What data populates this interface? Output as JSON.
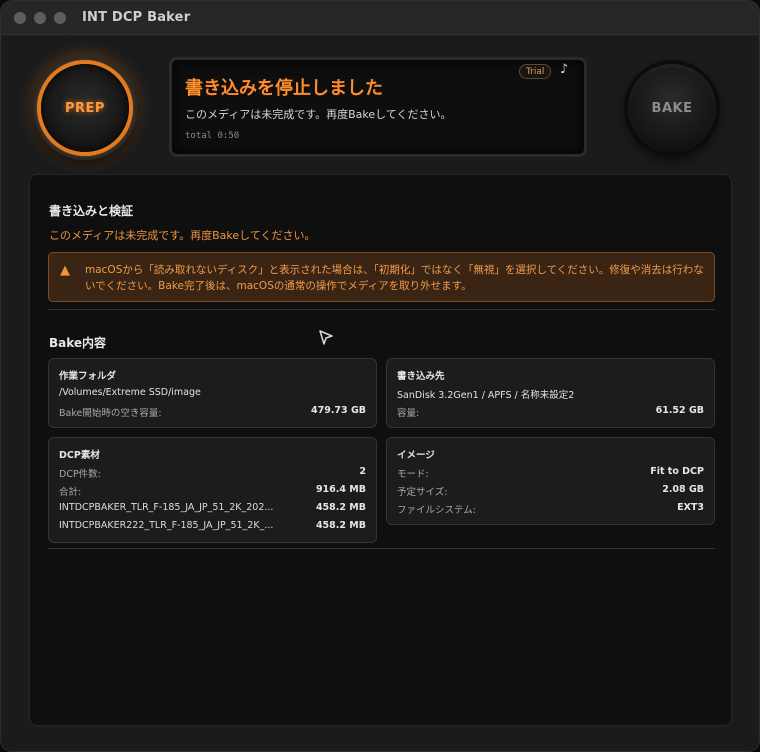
{
  "window": {
    "title": "INT DCP Baker"
  },
  "controls": {
    "prep_label": "PREP",
    "bake_label": "BAKE"
  },
  "status": {
    "title": "書き込みを停止しました",
    "subtitle": "このメディアは未完成です。再度Bakeしてください。",
    "total": "total 0:50",
    "badge": "Trial",
    "music_icon": "♪"
  },
  "write_verify": {
    "title": "書き込みと検証",
    "warning": "このメディアは未完成です。再度Bakeしてください。",
    "alert": "macOSから「読み取れないディスク」と表示された場合は、「初期化」ではなく「無視」を選択してください。修復や消去は行わないでください。Bake完了後は、macOSの通常の操作でメディアを取り外せます。",
    "alert_icon": "warning-triangle"
  },
  "bake_contents": {
    "title": "Bake内容",
    "work_folder": {
      "title": "作業フォルダ",
      "path": "/Volumes/Extreme SSD/image",
      "free_label": "Bake開始時の空き容量:",
      "free_value": "479.73 GB"
    },
    "destination": {
      "title": "書き込み先",
      "device": "SanDisk 3.2Gen1 / APFS / 名称未設定2",
      "capacity_label": "容量:",
      "capacity_value": "61.52 GB"
    },
    "dcp": {
      "title": "DCP素材",
      "rows": [
        {
          "key": "DCP件数:",
          "value": "2"
        },
        {
          "key": "合計:",
          "value": "916.4 MB"
        },
        {
          "key": "INTDCPBAKER_TLR_F-185_JA_JP_51_2K_202...",
          "value": "458.2 MB"
        },
        {
          "key": "INTDCPBAKER222_TLR_F-185_JA_JP_51_2K_...",
          "value": "458.2 MB"
        }
      ]
    },
    "image": {
      "title": "イメージ",
      "rows": [
        {
          "key": "モード:",
          "value": "Fit to DCP"
        },
        {
          "key": "予定サイズ:",
          "value": "2.08 GB"
        },
        {
          "key": "ファイルシステム:",
          "value": "EXT3"
        }
      ]
    }
  },
  "colors": {
    "accent": "#ff8c2a",
    "warning_bg": "#3a2414",
    "panel_bg": "#0f0f10"
  }
}
